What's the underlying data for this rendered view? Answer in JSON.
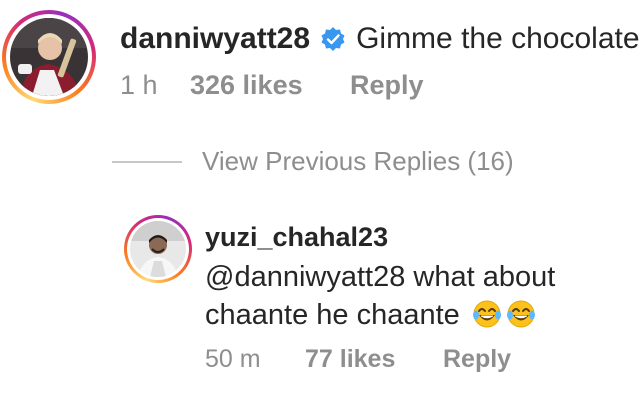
{
  "comment": {
    "username": "danniwyatt28",
    "verified": true,
    "text": "Gimme the chocolate",
    "time": "1 h",
    "likes": "326 likes",
    "reply": "Reply"
  },
  "view_previous_replies": "View Previous Replies (16)",
  "reply_comment": {
    "username": "yuzi_chahal23",
    "mention": "@danniwyatt28",
    "text_part1": " what about",
    "text_part2": "chaante he chaante",
    "emoji": [
      "face-with-tears-of-joy-icon",
      "face-with-tears-of-joy-icon"
    ],
    "time": "50 m",
    "likes": "77 likes",
    "reply": "Reply"
  },
  "colors": {
    "text": "#262626",
    "meta": "#8e8e8e",
    "verified_blue": "#3897f0",
    "divider": "#c7c7c7"
  }
}
